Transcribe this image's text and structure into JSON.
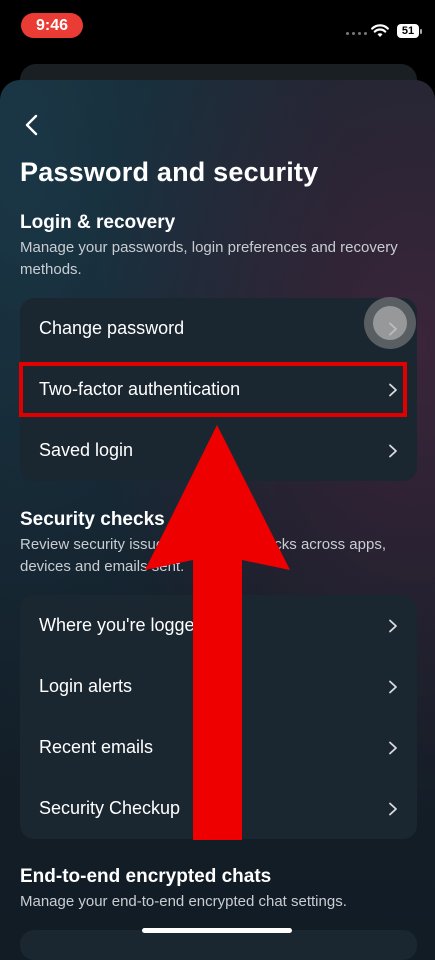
{
  "status_bar": {
    "time": "9:46",
    "battery": "51"
  },
  "header": {
    "title": "Password and security"
  },
  "sections": [
    {
      "title": "Login & recovery",
      "description": "Manage your passwords, login preferences and recovery methods.",
      "items": [
        {
          "label": "Change password"
        },
        {
          "label": "Two-factor authentication"
        },
        {
          "label": "Saved login"
        }
      ]
    },
    {
      "title": "Security checks",
      "description": "Review security issues by running checks across apps, devices and emails sent.",
      "items": [
        {
          "label": "Where you're logged in"
        },
        {
          "label": "Login alerts"
        },
        {
          "label": "Recent emails"
        },
        {
          "label": "Security Checkup"
        }
      ]
    },
    {
      "title": "End-to-end encrypted chats",
      "description": "Manage your end-to-end encrypted chat settings."
    }
  ],
  "colors": {
    "annotation_red": "#e00000",
    "card_bg": "#1b2730"
  }
}
